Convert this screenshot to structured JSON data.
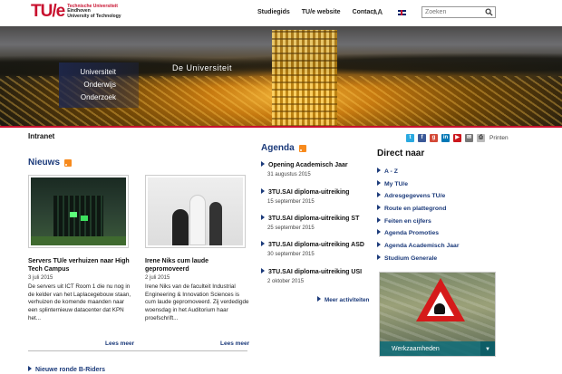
{
  "header": {
    "logo_mark": "TU/e",
    "logo_line1": "Technische Universiteit",
    "logo_line2": "Eindhoven",
    "logo_line3": "University of Technology",
    "nav": [
      "Studiegids",
      "TU/e website",
      "Contact"
    ],
    "font_size_large": "A",
    "font_size_small": "A",
    "search_placeholder": "Zoeken",
    "language_flag": "english-flag-icon"
  },
  "banner": {
    "title": "De Universiteit",
    "menu": [
      "Universiteit",
      "Onderwijs",
      "Onderzoek"
    ]
  },
  "page": {
    "breadcrumb": "Intranet",
    "print_label": "Printen",
    "social_icons": [
      "twitter-icon",
      "facebook-icon",
      "google-plus-icon",
      "linkedin-icon",
      "youtube-icon",
      "email-icon",
      "print-icon"
    ]
  },
  "news": {
    "title": "Nieuws",
    "items": [
      {
        "title": "Servers TU/e verhuizen naar High Tech Campus",
        "date": "3 juli 2015",
        "text": "De servers uit ICT Room 1 die nu nog in de kelder van het Laplacegebouw staan, verhuizen de komende maanden naar een splinternieuw datacenter dat KPN het...",
        "more": "Lees meer"
      },
      {
        "title": "Irene Niks cum laude gepromoveerd",
        "date": "2 juli 2015",
        "text": "Irene Niks van de faculteit Industrial Engineering & Innovation Sciences is cum laude gepromoveerd. Zij verdedigde woensdag in het Auditorium haar proefschrift...",
        "more": "Lees meer"
      }
    ],
    "next_title": "Nieuwe ronde B-Riders"
  },
  "agenda": {
    "title": "Agenda",
    "items": [
      {
        "title": "Opening Academisch Jaar",
        "date": "31 augustus 2015"
      },
      {
        "title": "3TU.SAI diploma-uitreiking",
        "date": "15 september 2015"
      },
      {
        "title": "3TU.SAI diploma-uitreiking ST",
        "date": "25 september 2015"
      },
      {
        "title": "3TU.SAI diploma-uitreiking ASD",
        "date": "30 september 2015"
      },
      {
        "title": "3TU.SAI diploma-uitreiking USI",
        "date": "2 oktober 2015"
      }
    ],
    "more": "Meer activiteiten"
  },
  "direct": {
    "title": "Direct naar",
    "items": [
      "A - Z",
      "My TU/e",
      "Adresgegevens TU/e",
      "Route en plattegrond",
      "Feiten en cijfers",
      "Agenda Promoties",
      "Agenda Academisch Jaar",
      "Studium Generale"
    ]
  },
  "werkzaamheden": {
    "label": "Werkzaamheden"
  },
  "colors": {
    "brand_red": "#c8102e",
    "link_blue": "#1b3a7a",
    "rss_orange": "#f78a1d",
    "teal_bar": "#146e78"
  }
}
